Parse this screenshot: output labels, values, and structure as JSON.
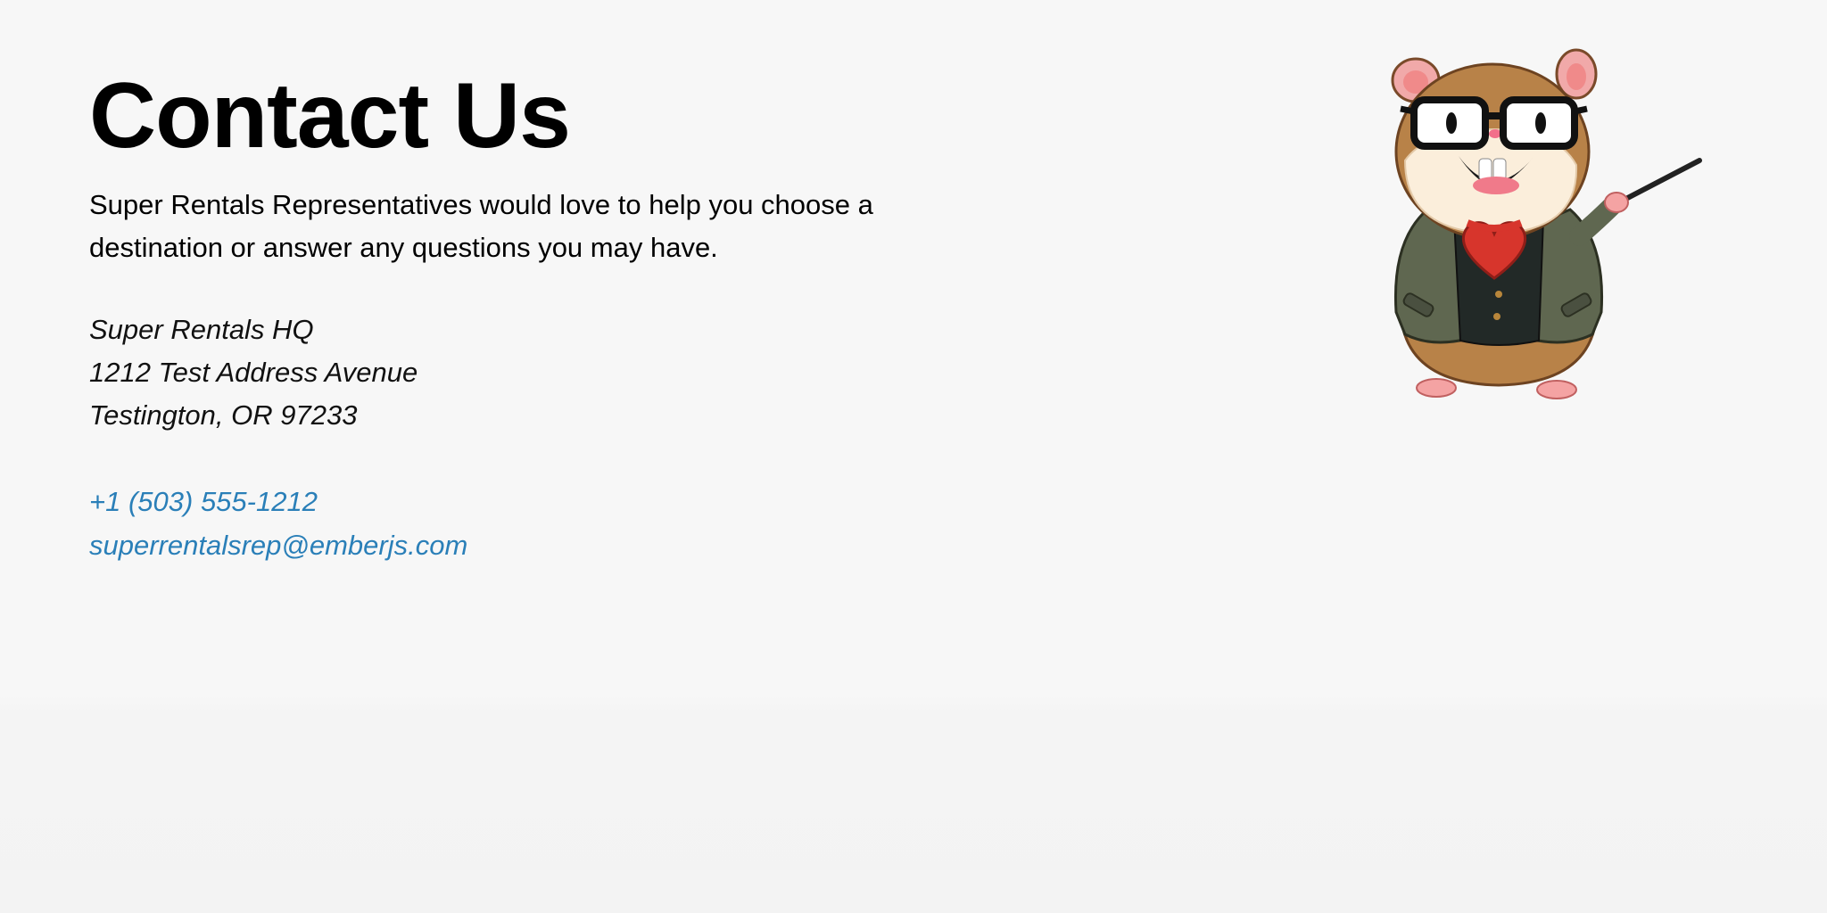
{
  "page": {
    "title": "Contact Us",
    "intro": "Super Rentals Representatives would love to help you choose a destination or answer any questions you may have."
  },
  "address": {
    "name": "Super Rentals HQ",
    "street": "1212 Test Address Avenue",
    "city": "Testington, OR 97233"
  },
  "contact": {
    "phone": "+1 (503) 555-1212",
    "email": "superrentalsrep@emberjs.com"
  },
  "mascot": {
    "icon": "tomster-mascot-icon"
  },
  "colors": {
    "background": "#f7f7f7",
    "link": "#2a7fb8",
    "text": "#000000"
  }
}
